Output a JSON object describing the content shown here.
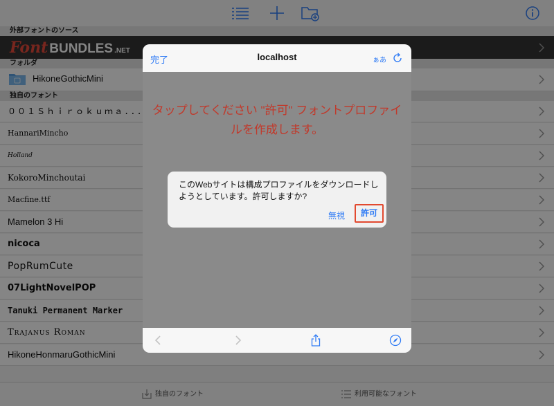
{
  "toolbar": {
    "list_icon": "list-icon",
    "add_icon": "plus-icon",
    "add_folder_icon": "folder-add-icon",
    "info_icon": "info-icon"
  },
  "sections": {
    "external": "外部フォントのソース",
    "folder": "フォルダ",
    "own_fonts": "独自のフォント"
  },
  "fontbundles": {
    "font": "Font",
    "bundles": "BUNDLES",
    "net": ".NET"
  },
  "folder": {
    "name": "HikoneGothicMini"
  },
  "fonts": [
    "００１Ｓｈｉｒｏｋｕｍａ...",
    "HannariMincho",
    "Holland",
    "KokoroMinchoutai",
    "Macfine.ttf",
    "Mamelon 3 Hi",
    "nicoca",
    "PopRumCute",
    "07LightNovelPOP",
    "Tanuki Permanent Marker",
    "Trajanus Roman",
    "HikoneHonmaruGothicMini"
  ],
  "bottom_bar": {
    "own_fonts": "独自のフォント",
    "available_fonts": "利用可能なフォント"
  },
  "sheet": {
    "done": "完了",
    "host": "localhost",
    "aa": "ぁあ",
    "instruction_line1": "タップしてください \"許可\" フォントプロファイ",
    "instruction_line2": "ルを作成します。"
  },
  "alert": {
    "message": "このWebサイトは構成プロファイルをダウンロードしようとしています。許可しますか?",
    "deny": "無視",
    "allow": "許可"
  },
  "colors": {
    "accent": "#2f7bf5",
    "instruction": "#c1392b",
    "highlight": "#e2492f",
    "fontbundles_red": "#e64a3a"
  }
}
